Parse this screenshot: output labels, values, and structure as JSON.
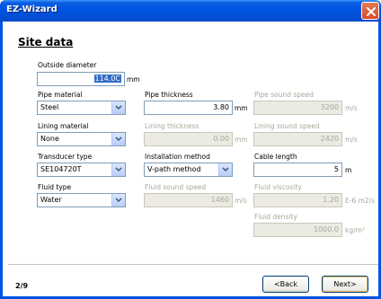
{
  "window": {
    "title": "EZ-Wizard"
  },
  "heading": "Site data",
  "outside_diameter": {
    "label": "Outside diameter",
    "value": "114.0C",
    "unit": "mm"
  },
  "pipe_material": {
    "label": "Pipe material",
    "value": "Steel"
  },
  "pipe_thickness": {
    "label": "Pipe thickness",
    "value": "3.80",
    "unit": "mm"
  },
  "pipe_sound_speed": {
    "label": "Pipe sound speed",
    "value": "3200",
    "unit": "m/s"
  },
  "lining_material": {
    "label": "Lining material",
    "value": "None"
  },
  "lining_thickness": {
    "label": "Lining thickness",
    "value": "0.00",
    "unit": "mm"
  },
  "lining_sound_speed": {
    "label": "Lining sound speed",
    "value": "2420",
    "unit": "m/s"
  },
  "transducer_type": {
    "label": "Transducer type",
    "value": "SE104720T"
  },
  "installation_method": {
    "label": "Installation method",
    "value": "V-path method"
  },
  "cable_length": {
    "label": "Cable length",
    "value": "5",
    "unit": "m"
  },
  "fluid_type": {
    "label": "Fluid type",
    "value": "Water"
  },
  "fluid_sound_speed": {
    "label": "Fluid sound speed",
    "value": "1460",
    "unit": "m/s"
  },
  "fluid_viscosity": {
    "label": "Fluid viscosity",
    "value": "1.20",
    "unit": "E-6 m2/s"
  },
  "fluid_density": {
    "label": "Fluid density",
    "value": "1000.0",
    "unit": "kg/m³"
  },
  "footer": {
    "page": "2/9",
    "back_label": "<Back",
    "next_label": "Next>"
  }
}
